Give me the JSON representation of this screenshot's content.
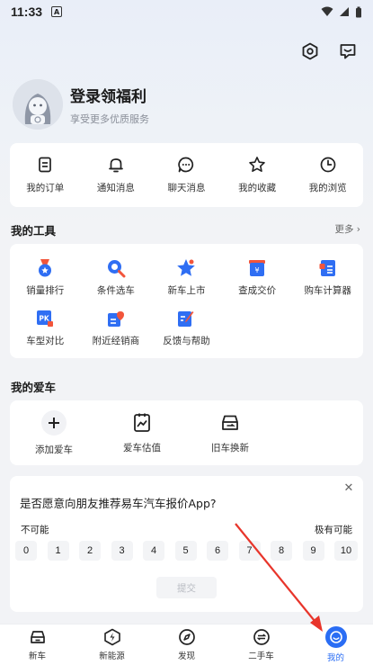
{
  "status_bar": {
    "time": "11:33",
    "notification": "A"
  },
  "top_actions": {
    "settings": "settings-hex-icon",
    "messages": "message-icon"
  },
  "profile": {
    "title": "登录领福利",
    "subtitle": "享受更多优质服务"
  },
  "quick_menu": [
    {
      "label": "我的订单",
      "icon": "order-icon"
    },
    {
      "label": "通知消息",
      "icon": "bell-icon"
    },
    {
      "label": "聊天消息",
      "icon": "chat-icon"
    },
    {
      "label": "我的收藏",
      "icon": "star-icon"
    },
    {
      "label": "我的浏览",
      "icon": "clock-icon"
    }
  ],
  "tools": {
    "title": "我的工具",
    "more": "更多",
    "items": [
      {
        "label": "销量排行",
        "icon": "medal-icon"
      },
      {
        "label": "条件选车",
        "icon": "search-icon"
      },
      {
        "label": "新车上市",
        "icon": "new-star-icon"
      },
      {
        "label": "查成交价",
        "icon": "price-icon"
      },
      {
        "label": "购车计算器",
        "icon": "calculator-icon"
      },
      {
        "label": "车型对比",
        "icon": "pk-icon"
      },
      {
        "label": "附近经销商",
        "icon": "dealer-icon"
      },
      {
        "label": "反馈与帮助",
        "icon": "feedback-icon"
      }
    ]
  },
  "my_car": {
    "title": "我的爱车",
    "items": [
      {
        "label": "添加爱车",
        "icon": "plus-icon"
      },
      {
        "label": "爱车估值",
        "icon": "valuation-icon"
      },
      {
        "label": "旧车换新",
        "icon": "trade-in-icon"
      }
    ]
  },
  "survey": {
    "question": "是否愿意向朋友推荐易车汽车报价App?",
    "low_label": "不可能",
    "high_label": "极有可能",
    "scale": [
      "0",
      "1",
      "2",
      "3",
      "4",
      "5",
      "6",
      "7",
      "8",
      "9",
      "10"
    ],
    "submit": "提交"
  },
  "tabbar": [
    {
      "label": "新车",
      "icon": "car-icon"
    },
    {
      "label": "新能源",
      "icon": "bolt-icon"
    },
    {
      "label": "发现",
      "icon": "compass-icon"
    },
    {
      "label": "二手车",
      "icon": "used-car-icon"
    },
    {
      "label": "我的",
      "icon": "profile-smile-icon",
      "active": true
    }
  ],
  "colors": {
    "accent": "#2a6df4",
    "annotation_arrow": "#e8352b"
  }
}
